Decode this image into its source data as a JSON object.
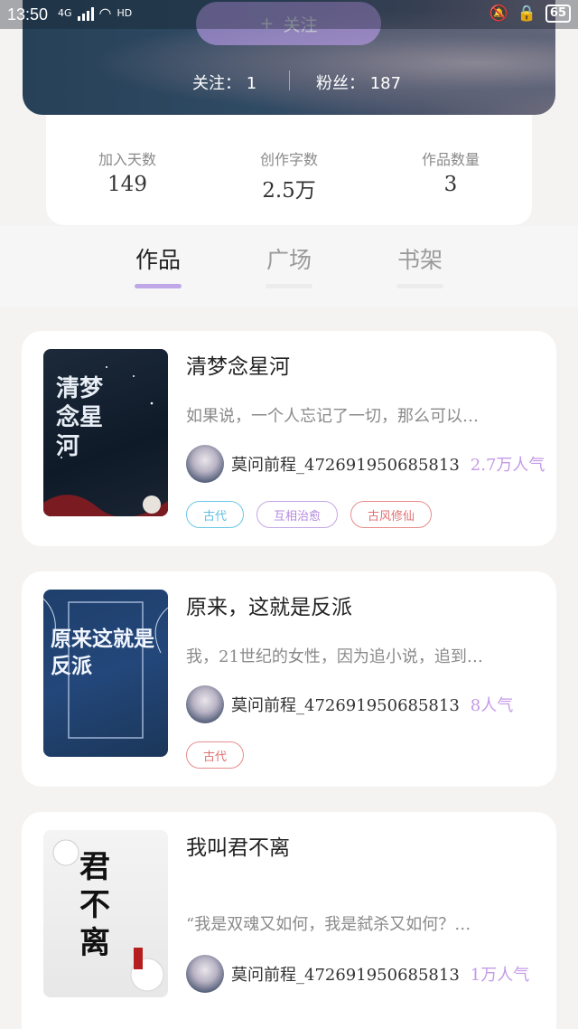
{
  "status": {
    "time": "13:50",
    "network": "4G",
    "wifi": "HD",
    "battery": "65"
  },
  "header": {
    "follow_label": "关注",
    "follow_plus": "+",
    "following": "关注： 1",
    "fans": "粉丝： 187"
  },
  "stats": [
    {
      "label": "加入天数",
      "value": "149"
    },
    {
      "label": "创作字数",
      "value": "2.5万"
    },
    {
      "label": "作品数量",
      "value": "3"
    }
  ],
  "tabs": [
    {
      "label": "作品"
    },
    {
      "label": "广场"
    },
    {
      "label": "书架"
    }
  ],
  "books": [
    {
      "title": "清梦念星河",
      "desc": "如果说，一个人忘记了一切，那么可以…",
      "author": "莫问前程_472691950685813",
      "popularity": "2.7万人气",
      "tags": [
        "古代",
        "互相治愈",
        "古风修仙"
      ],
      "cover_text": "清梦念星河"
    },
    {
      "title": "原来，这就是反派",
      "desc": "我，21世纪的女性，因为追小说，追到…",
      "author": "莫问前程_472691950685813",
      "popularity": "8人气",
      "tags": [
        "古代"
      ],
      "cover_text": "原来这就是反派"
    },
    {
      "title": "我叫君不离",
      "desc": "“我是双魂又如何，我是弑杀又如何？…",
      "author": "莫问前程_472691950685813",
      "popularity": "1万人气",
      "tags": [],
      "cover_text": "君不离"
    }
  ]
}
